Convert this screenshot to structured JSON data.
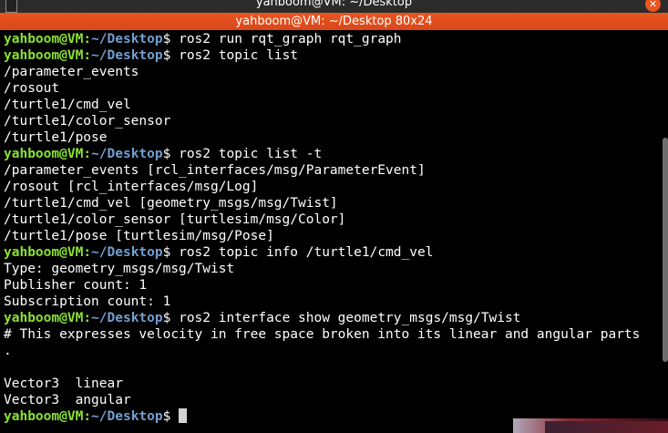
{
  "window": {
    "title": "yahboom@VM: ~/Desktop 80x24",
    "title_ghost": "yahboom@VM: ~/Desktop",
    "close_glyph": "✕"
  },
  "prompt": {
    "user_host": "yahboom@VM",
    "separator": ":",
    "path": "~/Desktop",
    "symbol": "$"
  },
  "lines": [
    {
      "type": "cmd",
      "text": " ros2 run rqt_graph rqt_graph"
    },
    {
      "type": "cmd",
      "text": " ros2 topic list"
    },
    {
      "type": "out",
      "text": "/parameter_events"
    },
    {
      "type": "out",
      "text": "/rosout"
    },
    {
      "type": "out",
      "text": "/turtle1/cmd_vel"
    },
    {
      "type": "out",
      "text": "/turtle1/color_sensor"
    },
    {
      "type": "out",
      "text": "/turtle1/pose"
    },
    {
      "type": "cmd",
      "text": " ros2 topic list -t"
    },
    {
      "type": "out",
      "text": "/parameter_events [rcl_interfaces/msg/ParameterEvent]"
    },
    {
      "type": "out",
      "text": "/rosout [rcl_interfaces/msg/Log]"
    },
    {
      "type": "out",
      "text": "/turtle1/cmd_vel [geometry_msgs/msg/Twist]"
    },
    {
      "type": "out",
      "text": "/turtle1/color_sensor [turtlesim/msg/Color]"
    },
    {
      "type": "out",
      "text": "/turtle1/pose [turtlesim/msg/Pose]"
    },
    {
      "type": "cmd",
      "text": " ros2 topic info /turtle1/cmd_vel"
    },
    {
      "type": "out",
      "text": "Type: geometry_msgs/msg/Twist"
    },
    {
      "type": "out",
      "text": "Publisher count: 1"
    },
    {
      "type": "out",
      "text": "Subscription count: 1"
    },
    {
      "type": "cmd",
      "text": " ros2 interface show geometry_msgs/msg/Twist"
    },
    {
      "type": "out",
      "text": "# This expresses velocity in free space broken into its linear and angular parts"
    },
    {
      "type": "out",
      "text": "."
    },
    {
      "type": "out",
      "text": ""
    },
    {
      "type": "out",
      "text": "Vector3  linear"
    },
    {
      "type": "out",
      "text": "Vector3  angular"
    }
  ],
  "colors": {
    "titlebar": "#e8561f",
    "user_host": "#8ae234",
    "path": "#729fcf",
    "text": "#ffffff",
    "background": "#000000"
  }
}
